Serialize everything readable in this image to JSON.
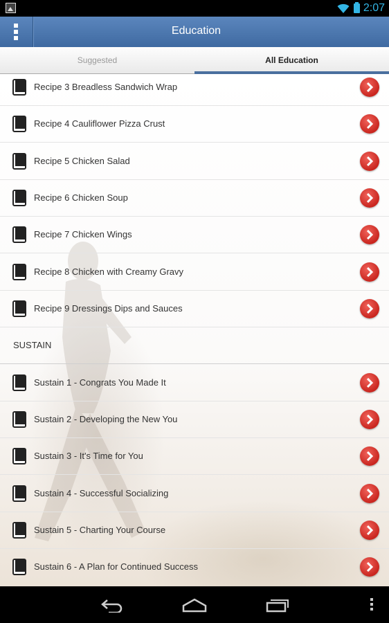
{
  "status_bar": {
    "time": "2:07",
    "icons": [
      "image-notification-icon",
      "wifi-icon",
      "battery-icon"
    ]
  },
  "header": {
    "title": "Education",
    "menu_icon": "overflow-menu-icon"
  },
  "tabs": [
    {
      "label": "Suggested",
      "active": false
    },
    {
      "label": "All Education",
      "active": true
    }
  ],
  "recipes": [
    {
      "label": "Recipe 3 Breadless Sandwich Wrap"
    },
    {
      "label": "Recipe 4 Cauliflower Pizza Crust"
    },
    {
      "label": "Recipe 5 Chicken Salad"
    },
    {
      "label": "Recipe 6 Chicken Soup"
    },
    {
      "label": "Recipe 7 Chicken Wings"
    },
    {
      "label": "Recipe 8 Chicken with Creamy Gravy"
    },
    {
      "label": "Recipe 9 Dressings Dips and Sauces"
    }
  ],
  "section_header": "SUSTAIN",
  "sustain": [
    {
      "label": "Sustain 1 - Congrats You Made It"
    },
    {
      "label": "Sustain 2 - Developing the New You"
    },
    {
      "label": "Sustain 3 - It's Time for You"
    },
    {
      "label": "Sustain 4 - Successful Socializing"
    },
    {
      "label": "Sustain 5 - Charting Your Course"
    },
    {
      "label": "Sustain 6 - A Plan for Continued Success"
    }
  ],
  "nav_bar": {
    "icons": [
      "back-icon",
      "home-icon",
      "recent-apps-icon",
      "overflow-icon"
    ]
  },
  "colors": {
    "header": "#4a73a8",
    "go_button": "#d9342c",
    "active_tab_indicator": "#4a6f9e"
  }
}
